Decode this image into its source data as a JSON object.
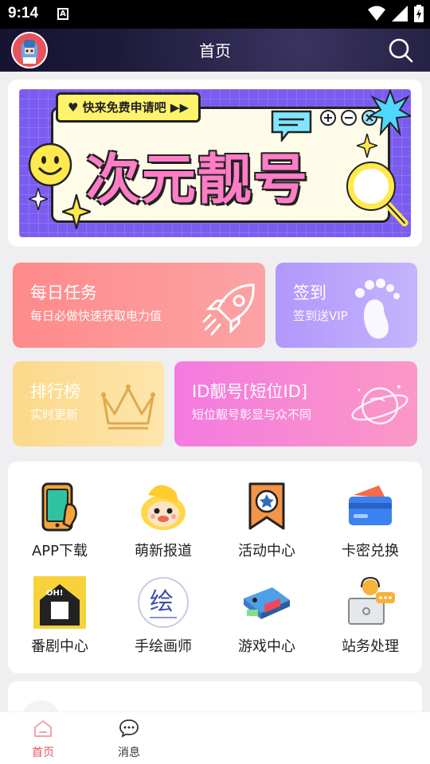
{
  "status_bar": {
    "time": "9:14",
    "notif_badge": "A"
  },
  "header": {
    "title": "首页"
  },
  "banner": {
    "tag": "快来免费申请吧",
    "headline": "次元靓号"
  },
  "cards": [
    {
      "title": "每日任务",
      "subtitle": "每日必做快速获取电力值",
      "colors": [
        "#fe8a8a",
        "#fc9fa1"
      ]
    },
    {
      "title": "签到",
      "subtitle": "签到送VIP",
      "colors": [
        "#b197fc",
        "#c3b2fd"
      ]
    },
    {
      "title": "排行榜",
      "subtitle": "实时更新",
      "colors": [
        "#fbd98a",
        "#fde3a6"
      ]
    },
    {
      "title": "ID靓号[短位ID]",
      "subtitle": "短位靓号彰显与众不同",
      "colors": [
        "#f47ae0",
        "#fb93c4"
      ]
    }
  ],
  "grid": [
    {
      "label": "APP下载",
      "icon": "phone-icon"
    },
    {
      "label": "萌新报道",
      "icon": "duck-mascot-icon"
    },
    {
      "label": "活动中心",
      "icon": "badge-star-icon"
    },
    {
      "label": "卡密兑换",
      "icon": "card-icon"
    },
    {
      "label": "番剧中心",
      "icon": "house-oh-icon"
    },
    {
      "label": "手绘画师",
      "icon": "paint-seal-icon"
    },
    {
      "label": "游戏中心",
      "icon": "game-console-icon"
    },
    {
      "label": "站务处理",
      "icon": "support-desk-icon"
    }
  ],
  "seal_text": "绘",
  "tabs": [
    {
      "label": "首页",
      "active": true
    },
    {
      "label": "消息",
      "active": false
    }
  ],
  "accent": "#e8535b"
}
